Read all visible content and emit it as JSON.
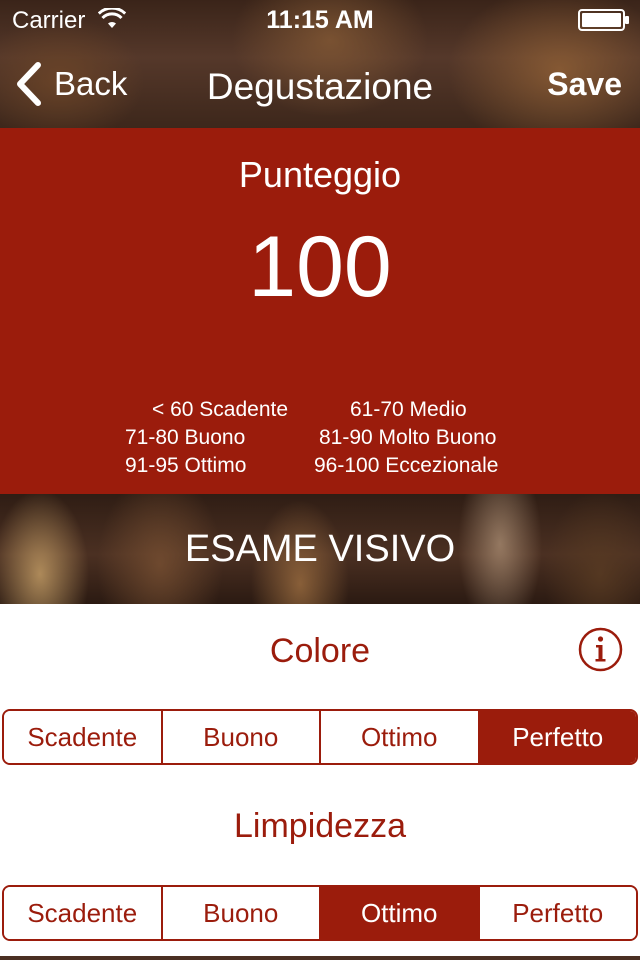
{
  "status_bar": {
    "carrier": "Carrier",
    "time": "11:15 AM",
    "icons": [
      "wifi-icon",
      "battery-icon"
    ]
  },
  "nav": {
    "back_label": "Back",
    "back_icon": "chevron-left-icon",
    "title": "Degustazione",
    "save_label": "Save"
  },
  "score": {
    "label": "Punteggio",
    "value": "100",
    "legend": [
      {
        "left": "< 60 Scadente",
        "right": "61-70  Medio"
      },
      {
        "left": "71-80 Buono",
        "right": "81-90 Molto Buono"
      },
      {
        "left": "91-95 Ottimo",
        "right": "96-100 Eccezionale"
      }
    ]
  },
  "section": {
    "title": "ESAME VISIVO"
  },
  "questions": [
    {
      "title": "Colore",
      "info_icon": "info-icon",
      "options": [
        "Scadente",
        "Buono",
        "Ottimo",
        "Perfetto"
      ],
      "selected": "Perfetto"
    },
    {
      "title": "Limpidezza",
      "options": [
        "Scadente",
        "Buono",
        "Ottimo",
        "Perfetto"
      ],
      "selected": "Ottimo"
    }
  ],
  "colors": {
    "accent": "#9b1c0c",
    "background": "#ffffff",
    "header_text": "#ffffff"
  }
}
